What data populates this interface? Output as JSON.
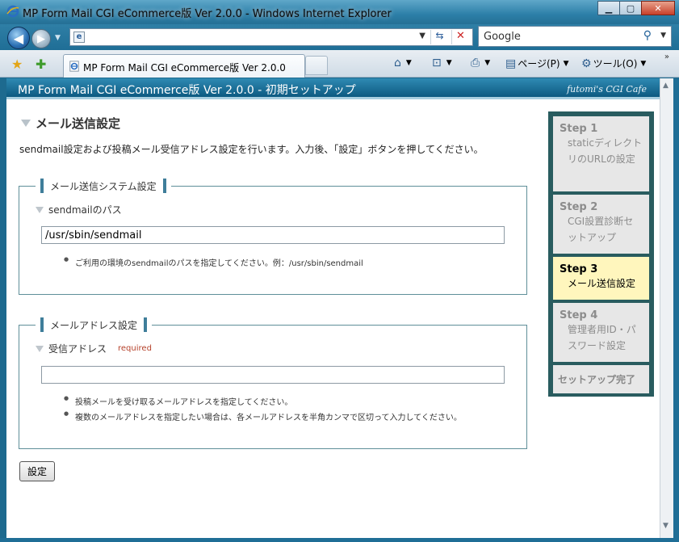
{
  "window": {
    "title": "MP Form Mail CGI eCommerce版 Ver 2.0.0 - Windows Internet Explorer",
    "minimize": "▁",
    "maximize": "▢",
    "close": "✕"
  },
  "nav": {
    "address_value": "",
    "search_placeholder": "Google"
  },
  "tabs": [
    {
      "label": "MP Form Mail CGI eCommerce版 Ver 2.0.0"
    }
  ],
  "commandbar": {
    "page_label": "ページ(P)",
    "tools_label": "ツール(O)"
  },
  "app": {
    "header_title": "MP Form Mail CGI eCommerce版 Ver 2.0.0 - 初期セットアップ",
    "brand": "futomi's CGI Cafe"
  },
  "main": {
    "heading": "メール送信設定",
    "intro": "sendmail設定および投稿メール受信アドレス設定を行います。入力後、「設定」ボタンを押してください。",
    "section1": {
      "legend": "メール送信システム設定",
      "field_label": "sendmailのパス",
      "field_value": "/usr/sbin/sendmail",
      "notes": [
        "ご利用の環境のsendmailのパスを指定してください。例：/usr/sbin/sendmail"
      ]
    },
    "section2": {
      "legend": "メールアドレス設定",
      "field_label": "受信アドレス",
      "required": "required",
      "field_value": "",
      "notes": [
        "投稿メールを受け取るメールアドレスを指定してください。",
        "複数のメールアドレスを指定したい場合は、各メールアドレスを半角カンマで区切って入力してください。"
      ]
    },
    "submit_label": "設定"
  },
  "steps": [
    {
      "num": "Step 1",
      "desc": "staticディレクトリのURLの設定"
    },
    {
      "num": "Step 2",
      "desc": "CGI設置診断セットアップ"
    },
    {
      "num": "Step 3",
      "desc": "メール送信設定"
    },
    {
      "num": "Step 4",
      "desc": "管理者用ID・パスワード設定"
    }
  ],
  "steps_final": "セットアップ完了",
  "colors": {
    "frame": "#1f6e96",
    "sidebar_bg": "#295c5f",
    "active_step": "#fff6bd",
    "required": "#b5412a"
  }
}
